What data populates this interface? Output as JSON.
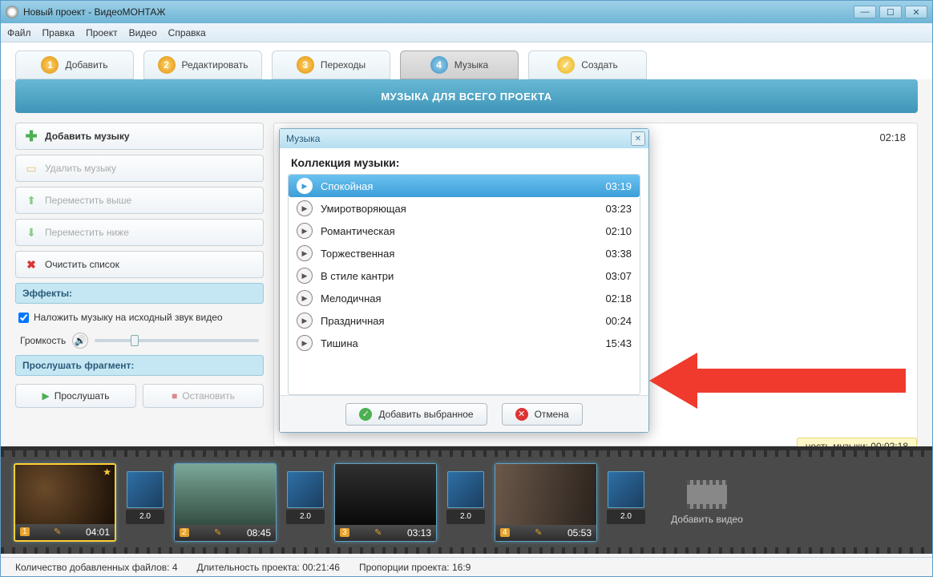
{
  "title": "Новый проект - ВидеоМОНТАЖ",
  "menu": {
    "file": "Файл",
    "edit": "Правка",
    "project": "Проект",
    "video": "Видео",
    "help": "Справка"
  },
  "steps": {
    "s1": "Добавить",
    "s2": "Редактировать",
    "s3": "Переходы",
    "s4": "Музыка",
    "s5": "Создать"
  },
  "banner": "МУЗЫКА ДЛЯ ВСЕГО ПРОЕКТА",
  "sidebar": {
    "add": "Добавить музыку",
    "del": "Удалить музыку",
    "up": "Переместить выше",
    "down": "Переместить ниже",
    "clear": "Очистить список",
    "effects": "Эффекты:",
    "overlay": "Наложить музыку на исходный звук видео",
    "volume": "Громкость",
    "preview": "Прослушать фрагмент:",
    "play": "Прослушать",
    "stop": "Остановить"
  },
  "timecode": "02:18",
  "musicbar": "ность музыки: 00:02:18",
  "modal": {
    "title": "Музыка",
    "header": "Коллекция музыки:",
    "tracks": [
      {
        "name": "Спокойная",
        "time": "03:19"
      },
      {
        "name": "Умиротворяющая",
        "time": "03:23"
      },
      {
        "name": "Романтическая",
        "time": "02:10"
      },
      {
        "name": "Торжественная",
        "time": "03:38"
      },
      {
        "name": "В стиле кантри",
        "time": "03:07"
      },
      {
        "name": "Мелодичная",
        "time": "02:18"
      },
      {
        "name": "Праздничная",
        "time": "00:24"
      },
      {
        "name": "Тишина",
        "time": "15:43"
      }
    ],
    "ok": "Добавить выбранное",
    "cancel": "Отмена"
  },
  "timeline": {
    "clips": [
      {
        "idx": "1",
        "dur": "04:01"
      },
      {
        "idx": "2",
        "dur": "08:45"
      },
      {
        "idx": "3",
        "dur": "03:13"
      },
      {
        "idx": "4",
        "dur": "05:53"
      }
    ],
    "trans": "2.0",
    "add": "Добавить видео"
  },
  "status": {
    "files": "Количество добавленных файлов: 4",
    "length": "Длительность проекта:  00:21:46",
    "ratio": "Пропорции проекта:  16:9"
  }
}
